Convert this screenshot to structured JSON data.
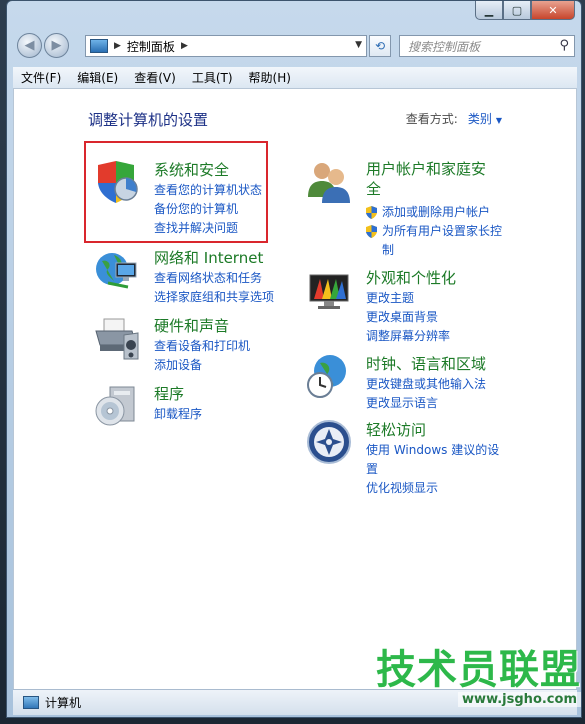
{
  "window": {
    "caption_minimize": "▁",
    "caption_maximize": "▢",
    "caption_close": "✕"
  },
  "nav": {
    "back_icon": "back-arrow-icon",
    "forward_icon": "forward-arrow-icon",
    "breadcrumb": "控制面板",
    "search_placeholder": "搜索控制面板"
  },
  "menu": {
    "items": [
      "文件(F)",
      "编辑(E)",
      "查看(V)",
      "工具(T)",
      "帮助(H)"
    ]
  },
  "content": {
    "title": "调整计算机的设置",
    "view_by_label": "查看方式:",
    "view_by_value": "类别",
    "left_categories": [
      {
        "title": "系统和安全",
        "links": [
          "查看您的计算机状态",
          "备份您的计算机",
          "查找并解决问题"
        ]
      },
      {
        "title": "网络和 Internet",
        "links": [
          "查看网络状态和任务",
          "选择家庭组和共享选项"
        ]
      },
      {
        "title": "硬件和声音",
        "links": [
          "查看设备和打印机",
          "添加设备"
        ]
      },
      {
        "title": "程序",
        "links": [
          "卸载程序"
        ]
      }
    ],
    "right_categories": [
      {
        "title_line1": "用户帐户和家庭安",
        "title_line2": "全",
        "links": [
          "添加或删除用户帐户",
          "为所有用户设置家长控",
          "制"
        ]
      },
      {
        "title": "外观和个性化",
        "links": [
          "更改主题",
          "更改桌面背景",
          "调整屏幕分辨率"
        ]
      },
      {
        "title": "时钟、语言和区域",
        "links": [
          "更改键盘或其他输入法",
          "更改显示语言"
        ]
      },
      {
        "title": "轻松访问",
        "links": [
          "使用 Windows 建议的设",
          "置",
          "优化视频显示"
        ]
      }
    ]
  },
  "status": {
    "text": "计算机"
  },
  "watermark": {
    "name": "技术员联盟",
    "url": "www.jsgho.com"
  },
  "colors": {
    "link": "#1a57c4",
    "category": "#1c7a27",
    "title": "#1e3287",
    "highlight": "#d9262d"
  }
}
